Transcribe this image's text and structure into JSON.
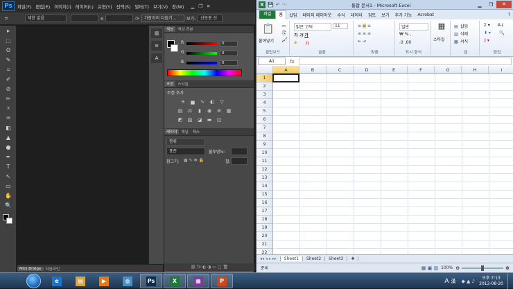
{
  "photoshop": {
    "logo": "Ps",
    "menus": [
      "파일(F)",
      "편집(E)",
      "이미지(I)",
      "레이어(L)",
      "유형(Y)",
      "선택(S)",
      "필터(T)",
      "보기(V)",
      "창(W)"
    ],
    "options": {
      "style_label": "제한 없음",
      "x_label": "x",
      "edge_button": "가장자리 다듬기...",
      "view_label": "보기:",
      "view_value": "산등봉 선"
    },
    "tools": [
      "▸",
      "⬚",
      "ʘ",
      "✎",
      "⌗",
      "✐",
      "⊘",
      "✏",
      "⚡",
      "♒",
      "◧",
      "▲",
      "●",
      "✒",
      "T",
      "↖",
      "▭",
      "✋",
      "🔍"
    ],
    "bridge_tabs": [
      "Mini Bridge",
      "타임라인"
    ],
    "color_panel": {
      "tabs": [
        "색상",
        "색상 견본"
      ],
      "channels": [
        {
          "label": "R",
          "value": "0"
        },
        {
          "label": "G",
          "value": "0"
        },
        {
          "label": "B",
          "value": "0"
        }
      ]
    },
    "adjust_panel": {
      "tabs": [
        "조정",
        "스타일"
      ],
      "title": "조정 추가"
    },
    "layers_panel": {
      "tabs": [
        "레이어",
        "채널",
        "패스"
      ],
      "kind_label": "종류",
      "blend_mode": "표준",
      "opacity_label": "불투명도:",
      "lock_label": "잠그기:",
      "fill_label": "칠:"
    }
  },
  "excel": {
    "icon": "X",
    "title": "통합 문서1 - Microsoft Excel",
    "tabs": [
      "파일",
      "홈",
      "삽입",
      "페이지 레이아웃",
      "수식",
      "데이터",
      "검토",
      "보기",
      "추가 기능",
      "Acrobat"
    ],
    "ribbon": {
      "paste_label": "붙여넣기",
      "font_name": "맑은 고딕",
      "font_size": "11",
      "number_format": "일반",
      "style_label": "스타일",
      "insert_label": "삽입",
      "delete_label": "삭제",
      "format_label": "서식",
      "groups": [
        "클립보드",
        "글꼴",
        "맞춤",
        "표시 형식",
        "셀",
        "편집"
      ]
    },
    "name_box": "A1",
    "fx_label": "fx",
    "columns": [
      "A",
      "B",
      "C",
      "D",
      "E",
      "F",
      "G",
      "H",
      "I"
    ],
    "rows": [
      "1",
      "2",
      "3",
      "4",
      "5",
      "6",
      "7",
      "8",
      "9",
      "10",
      "11",
      "12",
      "13",
      "14",
      "15",
      "16",
      "17",
      "18",
      "19",
      "20",
      "21",
      "22"
    ],
    "sheets": [
      "Sheet1",
      "Sheet2",
      "Sheet3"
    ],
    "status_ready": "준비",
    "zoom": "100%"
  },
  "taskbar": {
    "apps": [
      {
        "name": "internet-explorer",
        "icon": "e",
        "color": "#1e73c8"
      },
      {
        "name": "file-explorer",
        "icon": "▤",
        "color": "#d9a441"
      },
      {
        "name": "media-player",
        "icon": "▶",
        "color": "#e07b1c"
      },
      {
        "name": "network",
        "icon": "◍",
        "color": "#4a8fc4"
      },
      {
        "name": "photoshop",
        "icon": "Ps",
        "color": "#0e2d4e"
      },
      {
        "name": "excel",
        "icon": "X",
        "color": "#1f7a3a"
      },
      {
        "name": "winrar",
        "icon": "▦",
        "color": "#7a3b9b"
      },
      {
        "name": "powerpoint",
        "icon": "P",
        "color": "#c8471e"
      }
    ],
    "lang": "A",
    "ime": "漢",
    "ampm": "오후 7:13",
    "date": "2012-08-20"
  }
}
